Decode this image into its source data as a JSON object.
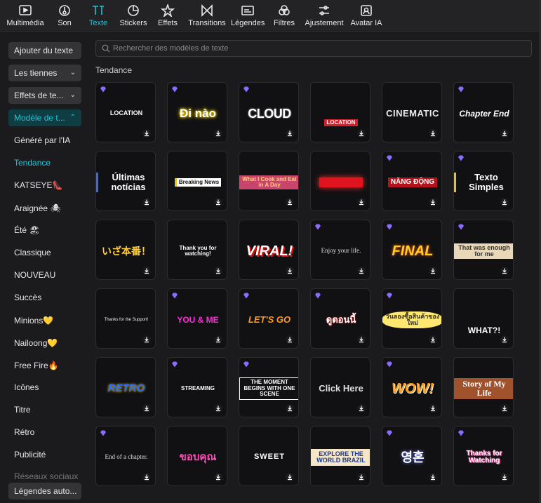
{
  "topbar": {
    "tabs": [
      {
        "label": "Multimédia",
        "icon": "media-icon",
        "active": false
      },
      {
        "label": "Son",
        "icon": "sound-icon",
        "active": false
      },
      {
        "label": "Texte",
        "icon": "text-icon",
        "active": true
      },
      {
        "label": "Stickers",
        "icon": "sticker-icon",
        "active": false
      },
      {
        "label": "Effets",
        "icon": "effects-icon",
        "active": false
      },
      {
        "label": "Transitions",
        "icon": "transitions-icon",
        "active": false
      },
      {
        "label": "Légendes",
        "icon": "captions-icon",
        "active": false
      },
      {
        "label": "Filtres",
        "icon": "filters-icon",
        "active": false
      },
      {
        "label": "Ajustement",
        "icon": "adjust-icon",
        "active": false
      },
      {
        "label": "Avatar IA",
        "icon": "avatar-icon",
        "active": false
      }
    ]
  },
  "sidebar": {
    "buttons": [
      {
        "label": "Ajouter du texte"
      },
      {
        "label": "Les tiennes",
        "chevron": "⌄"
      },
      {
        "label": "Effets de te...",
        "chevron": "⌄"
      },
      {
        "label": "Modèle de t...",
        "chevron": "⌃"
      }
    ],
    "items": [
      {
        "label": "Généré par l'IA",
        "active": false
      },
      {
        "label": "Tendance",
        "active": true
      },
      {
        "label": "KATSEYE👠",
        "active": false
      },
      {
        "label": "Araignée 🕷",
        "active": false
      },
      {
        "label": "Été 🏖",
        "active": false
      },
      {
        "label": "Classique",
        "active": false
      },
      {
        "label": "NOUVEAU",
        "active": false
      },
      {
        "label": "Succès",
        "active": false
      },
      {
        "label": "Minions💛",
        "active": false
      },
      {
        "label": "Nailoong💛",
        "active": false
      },
      {
        "label": "Free Fire🔥",
        "active": false
      },
      {
        "label": "Icônes",
        "active": false
      },
      {
        "label": "Titre",
        "active": false
      },
      {
        "label": "Rétro",
        "active": false
      },
      {
        "label": "Publicité",
        "active": false
      },
      {
        "label": "Réseaux sociaux",
        "active": false
      }
    ],
    "bottom_button": "Légendes auto..."
  },
  "search": {
    "placeholder": "Rechercher des modèles de texte"
  },
  "section_title": "Tendance",
  "templates": [
    {
      "text": "LOCATION",
      "premium": true
    },
    {
      "text": "Đi nào",
      "premium": true
    },
    {
      "text": "CLOUD",
      "premium": true
    },
    {
      "text": "LOCATION",
      "premium": false
    },
    {
      "text": "CINEMATIC",
      "premium": false
    },
    {
      "text": "Chapter End",
      "premium": true
    },
    {
      "text": "Últimas notícias",
      "premium": false
    },
    {
      "text": "Breaking News",
      "premium": false
    },
    {
      "text": "What I Cook and Eat in A Day",
      "premium": false
    },
    {
      "text": "",
      "premium": false
    },
    {
      "text": "NĂNG ĐỘNG",
      "premium": true
    },
    {
      "text": "Texto Simples",
      "premium": true
    },
    {
      "text": "いざ本番！",
      "premium": false
    },
    {
      "text": "Thank you for watching!",
      "premium": false
    },
    {
      "text": "VIRAL!",
      "premium": false
    },
    {
      "text": "Enjoy your life.",
      "premium": true
    },
    {
      "text": "FINAL",
      "premium": true
    },
    {
      "text": "That was enough for me",
      "premium": true
    },
    {
      "text": "Thanks for the Support!",
      "premium": false
    },
    {
      "text": "YOU & ME",
      "premium": true
    },
    {
      "text": "LET'S GO",
      "premium": true
    },
    {
      "text": "ดูตอนนี้",
      "premium": true
    },
    {
      "text": "วันลองซื้อสินค้าของใหม่",
      "premium": true
    },
    {
      "text": "WHAT?!",
      "premium": false
    },
    {
      "text": "RETRO",
      "premium": false
    },
    {
      "text": "STREAMING",
      "premium": true
    },
    {
      "text": "THE MOMENT BEGINS WITH ONE SCENE",
      "premium": true
    },
    {
      "text": "Click Here",
      "premium": false
    },
    {
      "text": "WOW!",
      "premium": true
    },
    {
      "text": "Story of My Life",
      "premium": false
    },
    {
      "text": "End of a chapter.",
      "premium": true
    },
    {
      "text": "ขอบคุณ",
      "premium": false
    },
    {
      "text": "SWEET",
      "premium": false
    },
    {
      "text": "EXPLORE THE WORLD BRAZIL",
      "premium": false
    },
    {
      "text": "영혼",
      "premium": true
    },
    {
      "text": "Thanks for Watching",
      "premium": true
    }
  ],
  "colors": {
    "accent": "#22c3d6",
    "premium": "#8b6cff",
    "background": "#1b1b1d"
  }
}
